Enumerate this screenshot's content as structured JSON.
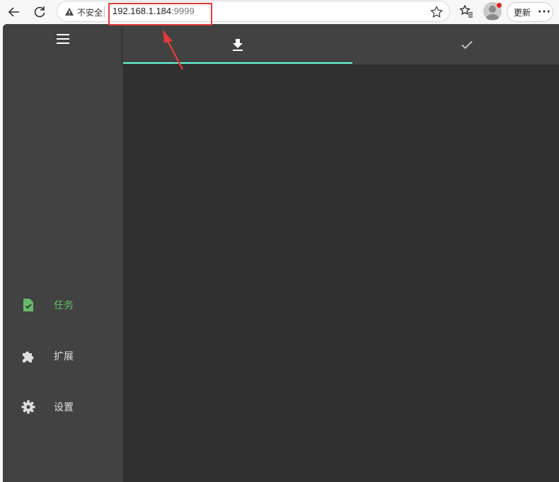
{
  "browser": {
    "security_label": "不安全",
    "url_host": "192.168.1.184",
    "url_port": ":9999",
    "update_label": "更新",
    "more_label": "···"
  },
  "app": {
    "tabs": [
      {
        "name": "downloading",
        "icon": "download-icon",
        "active": true
      },
      {
        "name": "completed",
        "icon": "check-icon",
        "active": false
      }
    ],
    "sidebar": {
      "items": [
        {
          "label": "任务",
          "icon": "task-file-icon",
          "active": true
        },
        {
          "label": "扩展",
          "icon": "puzzle-icon",
          "active": false
        },
        {
          "label": "设置",
          "icon": "gear-icon",
          "active": false
        }
      ]
    },
    "colors": {
      "accent_green": "#66bb6a",
      "tab_indicator": "#64ffda",
      "sidebar_bg": "#424242",
      "content_bg": "#303030"
    }
  },
  "annotation": {
    "highlight_color": "#e23a3a"
  }
}
